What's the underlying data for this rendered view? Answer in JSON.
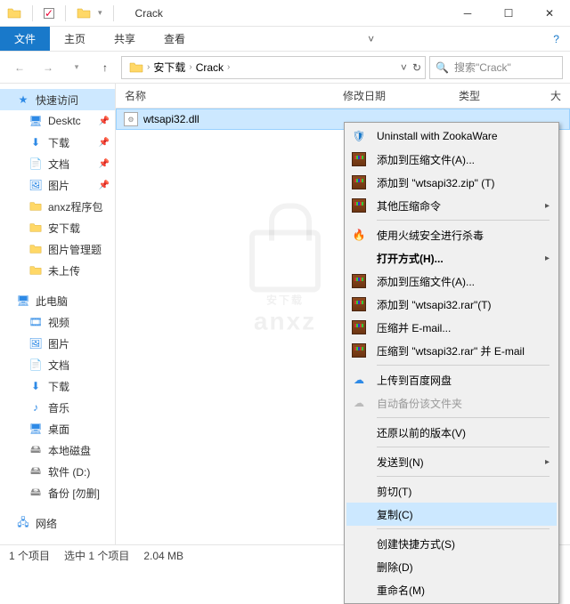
{
  "window": {
    "title": "Crack"
  },
  "ribbon": {
    "file": "文件",
    "tabs": [
      "主页",
      "共享",
      "查看"
    ]
  },
  "address": {
    "crumbs": [
      "安下载",
      "Crack"
    ]
  },
  "search": {
    "placeholder": "搜索\"Crack\""
  },
  "columns": {
    "name": "名称",
    "date": "修改日期",
    "type": "类型",
    "more": "大"
  },
  "file": {
    "name": "wtsapi32.dll"
  },
  "sidebar": {
    "quick": "快速访问",
    "quick_items": [
      "Desktc",
      "下载",
      "文档",
      "图片",
      "anxz程序包",
      "安下载",
      "图片管理题",
      "未上传"
    ],
    "thispc": "此电脑",
    "pc_items": [
      "视频",
      "图片",
      "文档",
      "下载",
      "音乐",
      "桌面",
      "本地磁盘",
      "软件 (D:)",
      "备份 [勿删]"
    ],
    "network": "网络"
  },
  "menu": {
    "uninstall": "Uninstall with ZookaWare",
    "add_archive": "添加到压缩文件(A)...",
    "add_zip": "添加到 \"wtsapi32.zip\" (T)",
    "other_zip": "其他压缩命令",
    "huorong": "使用火绒安全进行杀毒",
    "open_with": "打开方式(H)...",
    "add_rar_a": "添加到压缩文件(A)...",
    "add_rar_t": "添加到 \"wtsapi32.rar\"(T)",
    "rar_email": "压缩并 E-mail...",
    "rar_to_email": "压缩到 \"wtsapi32.rar\" 并 E-mail",
    "baidu": "上传到百度网盘",
    "autobackup": "自动备份该文件夹",
    "restore": "还原以前的版本(V)",
    "sendto": "发送到(N)",
    "cut": "剪切(T)",
    "copy": "复制(C)",
    "shortcut": "创建快捷方式(S)",
    "delete": "删除(D)",
    "rename": "重命名(M)"
  },
  "status": {
    "count": "1 个项目",
    "selection": "选中 1 个项目",
    "size": "2.04 MB"
  },
  "watermark": "anxz"
}
